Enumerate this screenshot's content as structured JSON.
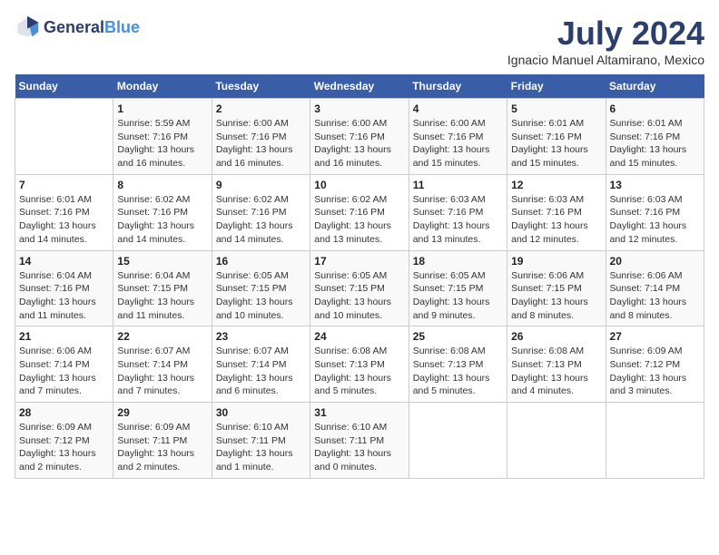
{
  "header": {
    "logo_general": "General",
    "logo_blue": "Blue",
    "title": "July 2024",
    "subtitle": "Ignacio Manuel Altamirano, Mexico"
  },
  "days_of_week": [
    "Sunday",
    "Monday",
    "Tuesday",
    "Wednesday",
    "Thursday",
    "Friday",
    "Saturday"
  ],
  "weeks": [
    {
      "days": [
        {
          "number": "",
          "sunrise": "",
          "sunset": "",
          "daylight": ""
        },
        {
          "number": "1",
          "sunrise": "Sunrise: 5:59 AM",
          "sunset": "Sunset: 7:16 PM",
          "daylight": "Daylight: 13 hours and 16 minutes."
        },
        {
          "number": "2",
          "sunrise": "Sunrise: 6:00 AM",
          "sunset": "Sunset: 7:16 PM",
          "daylight": "Daylight: 13 hours and 16 minutes."
        },
        {
          "number": "3",
          "sunrise": "Sunrise: 6:00 AM",
          "sunset": "Sunset: 7:16 PM",
          "daylight": "Daylight: 13 hours and 16 minutes."
        },
        {
          "number": "4",
          "sunrise": "Sunrise: 6:00 AM",
          "sunset": "Sunset: 7:16 PM",
          "daylight": "Daylight: 13 hours and 15 minutes."
        },
        {
          "number": "5",
          "sunrise": "Sunrise: 6:01 AM",
          "sunset": "Sunset: 7:16 PM",
          "daylight": "Daylight: 13 hours and 15 minutes."
        },
        {
          "number": "6",
          "sunrise": "Sunrise: 6:01 AM",
          "sunset": "Sunset: 7:16 PM",
          "daylight": "Daylight: 13 hours and 15 minutes."
        }
      ]
    },
    {
      "days": [
        {
          "number": "7",
          "sunrise": "Sunrise: 6:01 AM",
          "sunset": "Sunset: 7:16 PM",
          "daylight": "Daylight: 13 hours and 14 minutes."
        },
        {
          "number": "8",
          "sunrise": "Sunrise: 6:02 AM",
          "sunset": "Sunset: 7:16 PM",
          "daylight": "Daylight: 13 hours and 14 minutes."
        },
        {
          "number": "9",
          "sunrise": "Sunrise: 6:02 AM",
          "sunset": "Sunset: 7:16 PM",
          "daylight": "Daylight: 13 hours and 14 minutes."
        },
        {
          "number": "10",
          "sunrise": "Sunrise: 6:02 AM",
          "sunset": "Sunset: 7:16 PM",
          "daylight": "Daylight: 13 hours and 13 minutes."
        },
        {
          "number": "11",
          "sunrise": "Sunrise: 6:03 AM",
          "sunset": "Sunset: 7:16 PM",
          "daylight": "Daylight: 13 hours and 13 minutes."
        },
        {
          "number": "12",
          "sunrise": "Sunrise: 6:03 AM",
          "sunset": "Sunset: 7:16 PM",
          "daylight": "Daylight: 13 hours and 12 minutes."
        },
        {
          "number": "13",
          "sunrise": "Sunrise: 6:03 AM",
          "sunset": "Sunset: 7:16 PM",
          "daylight": "Daylight: 13 hours and 12 minutes."
        }
      ]
    },
    {
      "days": [
        {
          "number": "14",
          "sunrise": "Sunrise: 6:04 AM",
          "sunset": "Sunset: 7:16 PM",
          "daylight": "Daylight: 13 hours and 11 minutes."
        },
        {
          "number": "15",
          "sunrise": "Sunrise: 6:04 AM",
          "sunset": "Sunset: 7:15 PM",
          "daylight": "Daylight: 13 hours and 11 minutes."
        },
        {
          "number": "16",
          "sunrise": "Sunrise: 6:05 AM",
          "sunset": "Sunset: 7:15 PM",
          "daylight": "Daylight: 13 hours and 10 minutes."
        },
        {
          "number": "17",
          "sunrise": "Sunrise: 6:05 AM",
          "sunset": "Sunset: 7:15 PM",
          "daylight": "Daylight: 13 hours and 10 minutes."
        },
        {
          "number": "18",
          "sunrise": "Sunrise: 6:05 AM",
          "sunset": "Sunset: 7:15 PM",
          "daylight": "Daylight: 13 hours and 9 minutes."
        },
        {
          "number": "19",
          "sunrise": "Sunrise: 6:06 AM",
          "sunset": "Sunset: 7:15 PM",
          "daylight": "Daylight: 13 hours and 8 minutes."
        },
        {
          "number": "20",
          "sunrise": "Sunrise: 6:06 AM",
          "sunset": "Sunset: 7:14 PM",
          "daylight": "Daylight: 13 hours and 8 minutes."
        }
      ]
    },
    {
      "days": [
        {
          "number": "21",
          "sunrise": "Sunrise: 6:06 AM",
          "sunset": "Sunset: 7:14 PM",
          "daylight": "Daylight: 13 hours and 7 minutes."
        },
        {
          "number": "22",
          "sunrise": "Sunrise: 6:07 AM",
          "sunset": "Sunset: 7:14 PM",
          "daylight": "Daylight: 13 hours and 7 minutes."
        },
        {
          "number": "23",
          "sunrise": "Sunrise: 6:07 AM",
          "sunset": "Sunset: 7:14 PM",
          "daylight": "Daylight: 13 hours and 6 minutes."
        },
        {
          "number": "24",
          "sunrise": "Sunrise: 6:08 AM",
          "sunset": "Sunset: 7:13 PM",
          "daylight": "Daylight: 13 hours and 5 minutes."
        },
        {
          "number": "25",
          "sunrise": "Sunrise: 6:08 AM",
          "sunset": "Sunset: 7:13 PM",
          "daylight": "Daylight: 13 hours and 5 minutes."
        },
        {
          "number": "26",
          "sunrise": "Sunrise: 6:08 AM",
          "sunset": "Sunset: 7:13 PM",
          "daylight": "Daylight: 13 hours and 4 minutes."
        },
        {
          "number": "27",
          "sunrise": "Sunrise: 6:09 AM",
          "sunset": "Sunset: 7:12 PM",
          "daylight": "Daylight: 13 hours and 3 minutes."
        }
      ]
    },
    {
      "days": [
        {
          "number": "28",
          "sunrise": "Sunrise: 6:09 AM",
          "sunset": "Sunset: 7:12 PM",
          "daylight": "Daylight: 13 hours and 2 minutes."
        },
        {
          "number": "29",
          "sunrise": "Sunrise: 6:09 AM",
          "sunset": "Sunset: 7:11 PM",
          "daylight": "Daylight: 13 hours and 2 minutes."
        },
        {
          "number": "30",
          "sunrise": "Sunrise: 6:10 AM",
          "sunset": "Sunset: 7:11 PM",
          "daylight": "Daylight: 13 hours and 1 minute."
        },
        {
          "number": "31",
          "sunrise": "Sunrise: 6:10 AM",
          "sunset": "Sunset: 7:11 PM",
          "daylight": "Daylight: 13 hours and 0 minutes."
        },
        {
          "number": "",
          "sunrise": "",
          "sunset": "",
          "daylight": ""
        },
        {
          "number": "",
          "sunrise": "",
          "sunset": "",
          "daylight": ""
        },
        {
          "number": "",
          "sunrise": "",
          "sunset": "",
          "daylight": ""
        }
      ]
    }
  ]
}
